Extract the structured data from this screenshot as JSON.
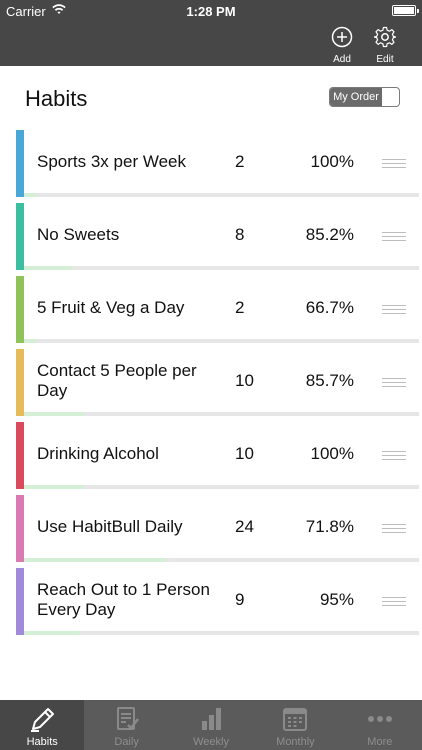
{
  "status_bar": {
    "carrier": "Carrier",
    "time": "1:28 PM"
  },
  "nav": {
    "add_label": "Add",
    "edit_label": "Edit"
  },
  "header": {
    "title": "Habits",
    "order_toggle_label": "My Order"
  },
  "habits": [
    {
      "name": "Sports 3x per Week",
      "count": "2",
      "percent": "100%",
      "color": "#4aa8d8",
      "progress": 0.03
    },
    {
      "name": "No Sweets",
      "count": "8",
      "percent": "85.2%",
      "color": "#3bbfa0",
      "progress": 0.12
    },
    {
      "name": "5 Fruit & Veg a Day",
      "count": "2",
      "percent": "66.7%",
      "color": "#8fc35a",
      "progress": 0.03
    },
    {
      "name": "Contact 5 People per Day",
      "count": "10",
      "percent": "85.7%",
      "color": "#e6bb5a",
      "progress": 0.15
    },
    {
      "name": "Drinking Alcohol",
      "count": "10",
      "percent": "100%",
      "color": "#d94a5c",
      "progress": 0.15
    },
    {
      "name": "Use HabitBull Daily",
      "count": "24",
      "percent": "71.8%",
      "color": "#d97ab3",
      "progress": 0.36
    },
    {
      "name": "Reach Out to 1 Person Every Day",
      "count": "9",
      "percent": "95%",
      "color": "#a08ad9",
      "progress": 0.14
    }
  ],
  "tabs": [
    {
      "label": "Habits",
      "icon": "pencil-icon",
      "active": true
    },
    {
      "label": "Daily",
      "icon": "checklist-icon",
      "active": false
    },
    {
      "label": "Weekly",
      "icon": "bar-chart-icon",
      "active": false
    },
    {
      "label": "Monthly",
      "icon": "calendar-icon",
      "active": false
    },
    {
      "label": "More",
      "icon": "more-dots-icon",
      "active": false
    }
  ]
}
